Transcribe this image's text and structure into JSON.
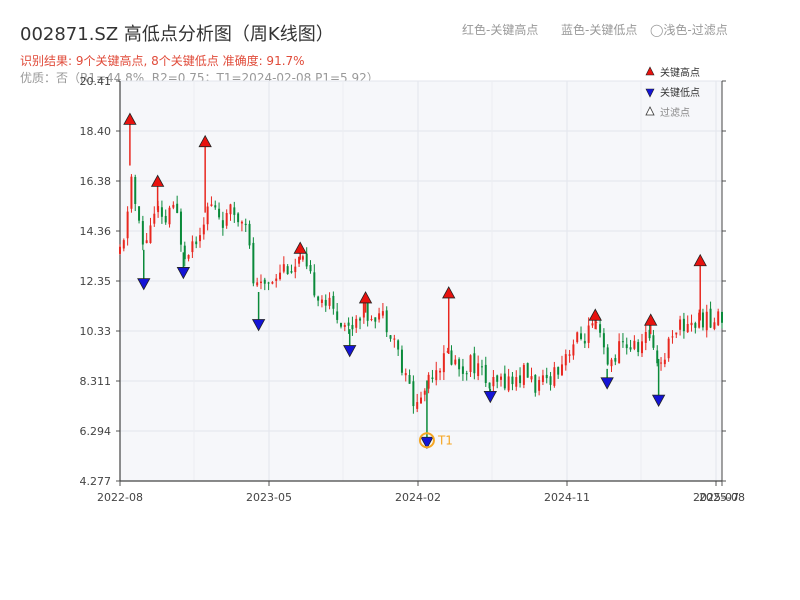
{
  "header": {
    "title": "002871.SZ 高低点分析图（周K线图）",
    "result": "识别结果: 9个关键高点, 8个关键低点  准确度: 91.7%",
    "quality": "优质：否（R1=44.8%, R2=0.75；T1=2024-02-08 P1=5.92）",
    "hint_red": "红色-关键高点",
    "hint_blue": "蓝色-关键低点",
    "hint_light": "◯浅色-过滤点"
  },
  "colors": {
    "up": "#e8271f",
    "down": "#0a8a3a",
    "high": "#e8120f",
    "low": "#1414d6",
    "t1": "#f5a623"
  },
  "chart_data": {
    "type": "candlestick",
    "y_ticks": [
      "4.277",
      "6.294",
      "8.311",
      "10.33",
      "12.35",
      "14.36",
      "16.38",
      "18.40",
      "20.41"
    ],
    "ylim": [
      4.277,
      20.41
    ],
    "x_ticks": [
      "2022-08",
      "2023-05",
      "2024-02",
      "2024-11",
      "2025-07",
      "2025-08"
    ],
    "xlim": [
      2022.53,
      2025.57
    ],
    "legend": [
      {
        "label": "关键高点",
        "kind": "high"
      },
      {
        "label": "关键低点",
        "kind": "low"
      },
      {
        "label": "过滤点",
        "kind": "filtered"
      }
    ],
    "key_highs": [
      {
        "t": 2022.58,
        "price": 18.7
      },
      {
        "t": 2022.72,
        "price": 16.2
      },
      {
        "t": 2022.96,
        "price": 17.8
      },
      {
        "t": 2023.44,
        "price": 13.5
      },
      {
        "t": 2023.77,
        "price": 11.5
      },
      {
        "t": 2024.19,
        "price": 11.7
      },
      {
        "t": 2024.93,
        "price": 10.8
      },
      {
        "t": 2025.21,
        "price": 10.6
      },
      {
        "t": 2025.46,
        "price": 13.0
      }
    ],
    "key_lows": [
      {
        "t": 2022.65,
        "price": 12.4
      },
      {
        "t": 2022.85,
        "price": 12.85
      },
      {
        "t": 2023.23,
        "price": 10.75
      },
      {
        "t": 2023.69,
        "price": 9.7
      },
      {
        "t": 2024.08,
        "price": 6.0
      },
      {
        "t": 2024.4,
        "price": 7.85
      },
      {
        "t": 2024.99,
        "price": 8.4
      },
      {
        "t": 2025.25,
        "price": 7.7
      }
    ],
    "t1": {
      "label": "T1",
      "t": 2024.08,
      "price": 5.92
    },
    "price_path": [
      [
        2022.53,
        13.4
      ],
      [
        2022.56,
        14.0
      ],
      [
        2022.58,
        17.0
      ],
      [
        2022.61,
        15.2
      ],
      [
        2022.65,
        13.6
      ],
      [
        2022.68,
        14.6
      ],
      [
        2022.72,
        15.2
      ],
      [
        2022.75,
        14.4
      ],
      [
        2022.78,
        15.3
      ],
      [
        2022.82,
        14.9
      ],
      [
        2022.85,
        13.5
      ],
      [
        2022.88,
        13.8
      ],
      [
        2022.92,
        14.2
      ],
      [
        2022.96,
        15.1
      ],
      [
        2022.99,
        15.4
      ],
      [
        2023.03,
        15.0
      ],
      [
        2023.06,
        14.7
      ],
      [
        2023.1,
        15.2
      ],
      [
        2023.13,
        14.8
      ],
      [
        2023.16,
        15.3
      ],
      [
        2023.2,
        12.4
      ],
      [
        2023.23,
        11.9
      ],
      [
        2023.27,
        12.3
      ],
      [
        2023.3,
        12.5
      ],
      [
        2023.34,
        12.9
      ],
      [
        2023.38,
        13.0
      ],
      [
        2023.41,
        12.8
      ],
      [
        2023.44,
        13.2
      ],
      [
        2023.47,
        12.7
      ],
      [
        2023.51,
        12.1
      ],
      [
        2023.54,
        11.8
      ],
      [
        2023.58,
        11.4
      ],
      [
        2023.61,
        11.1
      ],
      [
        2023.65,
        10.8
      ],
      [
        2023.69,
        10.4
      ],
      [
        2023.72,
        10.9
      ],
      [
        2023.75,
        11.2
      ],
      [
        2023.78,
        11.0
      ],
      [
        2023.82,
        11.1
      ],
      [
        2023.85,
        11.0
      ],
      [
        2023.89,
        10.5
      ],
      [
        2023.92,
        10.0
      ],
      [
        2023.96,
        8.5
      ],
      [
        2023.99,
        8.2
      ],
      [
        2024.02,
        7.2
      ],
      [
        2024.06,
        7.8
      ],
      [
        2024.09,
        8.6
      ],
      [
        2024.12,
        8.9
      ],
      [
        2024.16,
        9.1
      ],
      [
        2024.19,
        9.4
      ],
      [
        2024.23,
        9.0
      ],
      [
        2024.26,
        8.8
      ],
      [
        2024.3,
        9.1
      ],
      [
        2024.33,
        8.9
      ],
      [
        2024.37,
        8.5
      ],
      [
        2024.4,
        8.0
      ],
      [
        2024.44,
        8.2
      ],
      [
        2024.47,
        8.4
      ],
      [
        2024.51,
        8.3
      ],
      [
        2024.55,
        8.5
      ],
      [
        2024.58,
        8.7
      ],
      [
        2024.62,
        8.2
      ],
      [
        2024.65,
        8.0
      ],
      [
        2024.69,
        8.4
      ],
      [
        2024.72,
        8.7
      ],
      [
        2024.76,
        9.1
      ],
      [
        2024.79,
        9.6
      ],
      [
        2024.83,
        9.9
      ],
      [
        2024.86,
        10.0
      ],
      [
        2024.9,
        10.3
      ],
      [
        2024.93,
        10.4
      ],
      [
        2024.96,
        9.9
      ],
      [
        2024.99,
        8.8
      ],
      [
        2025.03,
        9.4
      ],
      [
        2025.06,
        9.7
      ],
      [
        2025.1,
        9.8
      ],
      [
        2025.13,
        9.6
      ],
      [
        2025.17,
        9.9
      ],
      [
        2025.21,
        10.2
      ],
      [
        2025.24,
        9.3
      ],
      [
        2025.27,
        9.0
      ],
      [
        2025.31,
        10.2
      ],
      [
        2025.34,
        10.6
      ],
      [
        2025.38,
        10.5
      ],
      [
        2025.41,
        10.8
      ],
      [
        2025.44,
        10.6
      ],
      [
        2025.48,
        10.9
      ],
      [
        2025.51,
        10.6
      ],
      [
        2025.54,
        10.8
      ],
      [
        2025.57,
        10.9
      ]
    ]
  }
}
